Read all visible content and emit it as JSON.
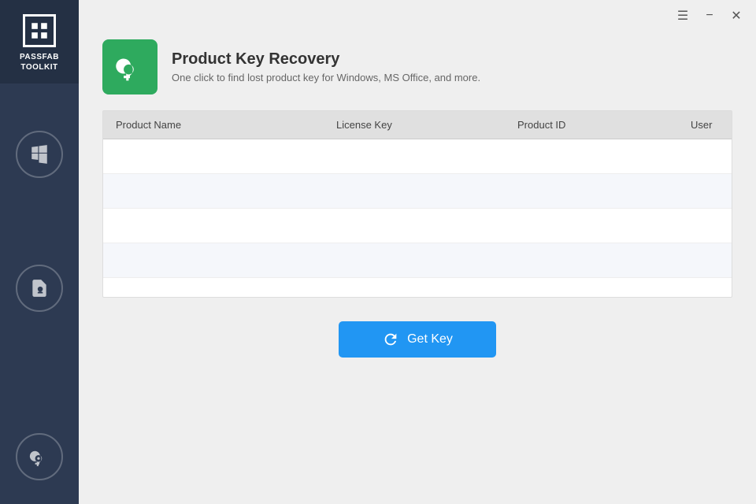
{
  "sidebar": {
    "logo_text": "PASSFAB\nTOOLKIT",
    "items": [
      {
        "id": "windows",
        "label": "Windows",
        "icon": "windows-icon"
      },
      {
        "id": "file-key",
        "label": "File Key",
        "icon": "file-key-icon"
      },
      {
        "id": "product-key",
        "label": "Product Key",
        "icon": "product-key-icon"
      }
    ]
  },
  "titlebar": {
    "menu_label": "☰",
    "minimize_label": "−",
    "close_label": "✕"
  },
  "header": {
    "title": "Product Key Recovery",
    "subtitle": "One click to find lost product key for Windows, MS Office, and more."
  },
  "table": {
    "columns": [
      "Product Name",
      "License Key",
      "Product ID",
      "User"
    ],
    "rows": []
  },
  "button": {
    "label": "Get Key"
  }
}
